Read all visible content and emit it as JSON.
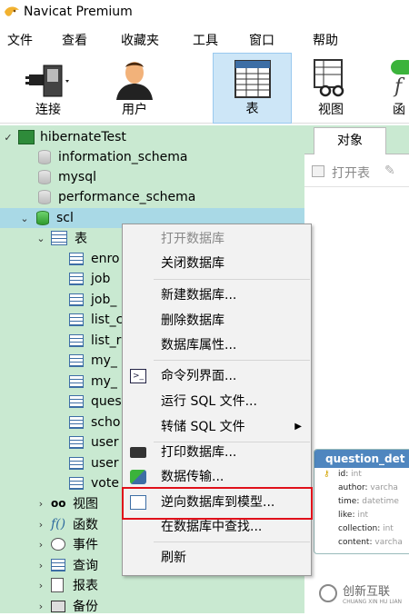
{
  "window": {
    "title": "Navicat Premium"
  },
  "menu": [
    "文件",
    "查看",
    "收藏夹",
    "工具",
    "窗口",
    "帮助"
  ],
  "toolbar": [
    {
      "label": "连接",
      "icon": "plug-icon"
    },
    {
      "label": "用户",
      "icon": "user-icon"
    },
    {
      "label": "表",
      "icon": "table-icon",
      "active": true
    },
    {
      "label": "视图",
      "icon": "view-icon"
    },
    {
      "label": "函",
      "icon": "function-icon"
    }
  ],
  "tree": {
    "connection": "hibernateTest",
    "databases": [
      "information_schema",
      "mysql",
      "performance_schema",
      "scl"
    ],
    "tables_node": "表",
    "tables": [
      "enro",
      "job",
      "job_",
      "list_c",
      "list_r",
      "my_",
      "my_",
      "ques",
      "scho",
      "user",
      "user",
      "vote"
    ],
    "nodes": [
      "视图",
      "函数",
      "事件",
      "查询",
      "报表",
      "备份"
    ]
  },
  "right_panel": {
    "tab": "对象",
    "open_table": "打开表",
    "model": {
      "title": "question_det",
      "fields": [
        {
          "name": "id",
          "type": "int"
        },
        {
          "name": "author",
          "type": "varcha"
        },
        {
          "name": "time",
          "type": "datetime"
        },
        {
          "name": "like",
          "type": "int"
        },
        {
          "name": "collection",
          "type": "int"
        },
        {
          "name": "content",
          "type": "varcha"
        }
      ]
    },
    "watermark": "创新互联",
    "watermark_sub": "CHUANG XIN HU LIAN"
  },
  "context_menu": {
    "items": [
      {
        "label": "打开数据库",
        "disabled": true
      },
      {
        "label": "关闭数据库"
      },
      {
        "label": "新建数据库..."
      },
      {
        "label": "删除数据库"
      },
      {
        "label": "数据库属性..."
      },
      {
        "label": "命令列界面..."
      },
      {
        "label": "运行 SQL 文件..."
      },
      {
        "label": "转储 SQL 文件"
      },
      {
        "label": "打印数据库..."
      },
      {
        "label": "数据传输..."
      },
      {
        "label": "逆向数据库到模型..."
      },
      {
        "label": "在数据库中查找..."
      },
      {
        "label": "刷新"
      }
    ]
  },
  "colors": {
    "accent": "#4f86bf",
    "tree_bg": "#c9e9d1",
    "highlight": "#e0101a"
  }
}
